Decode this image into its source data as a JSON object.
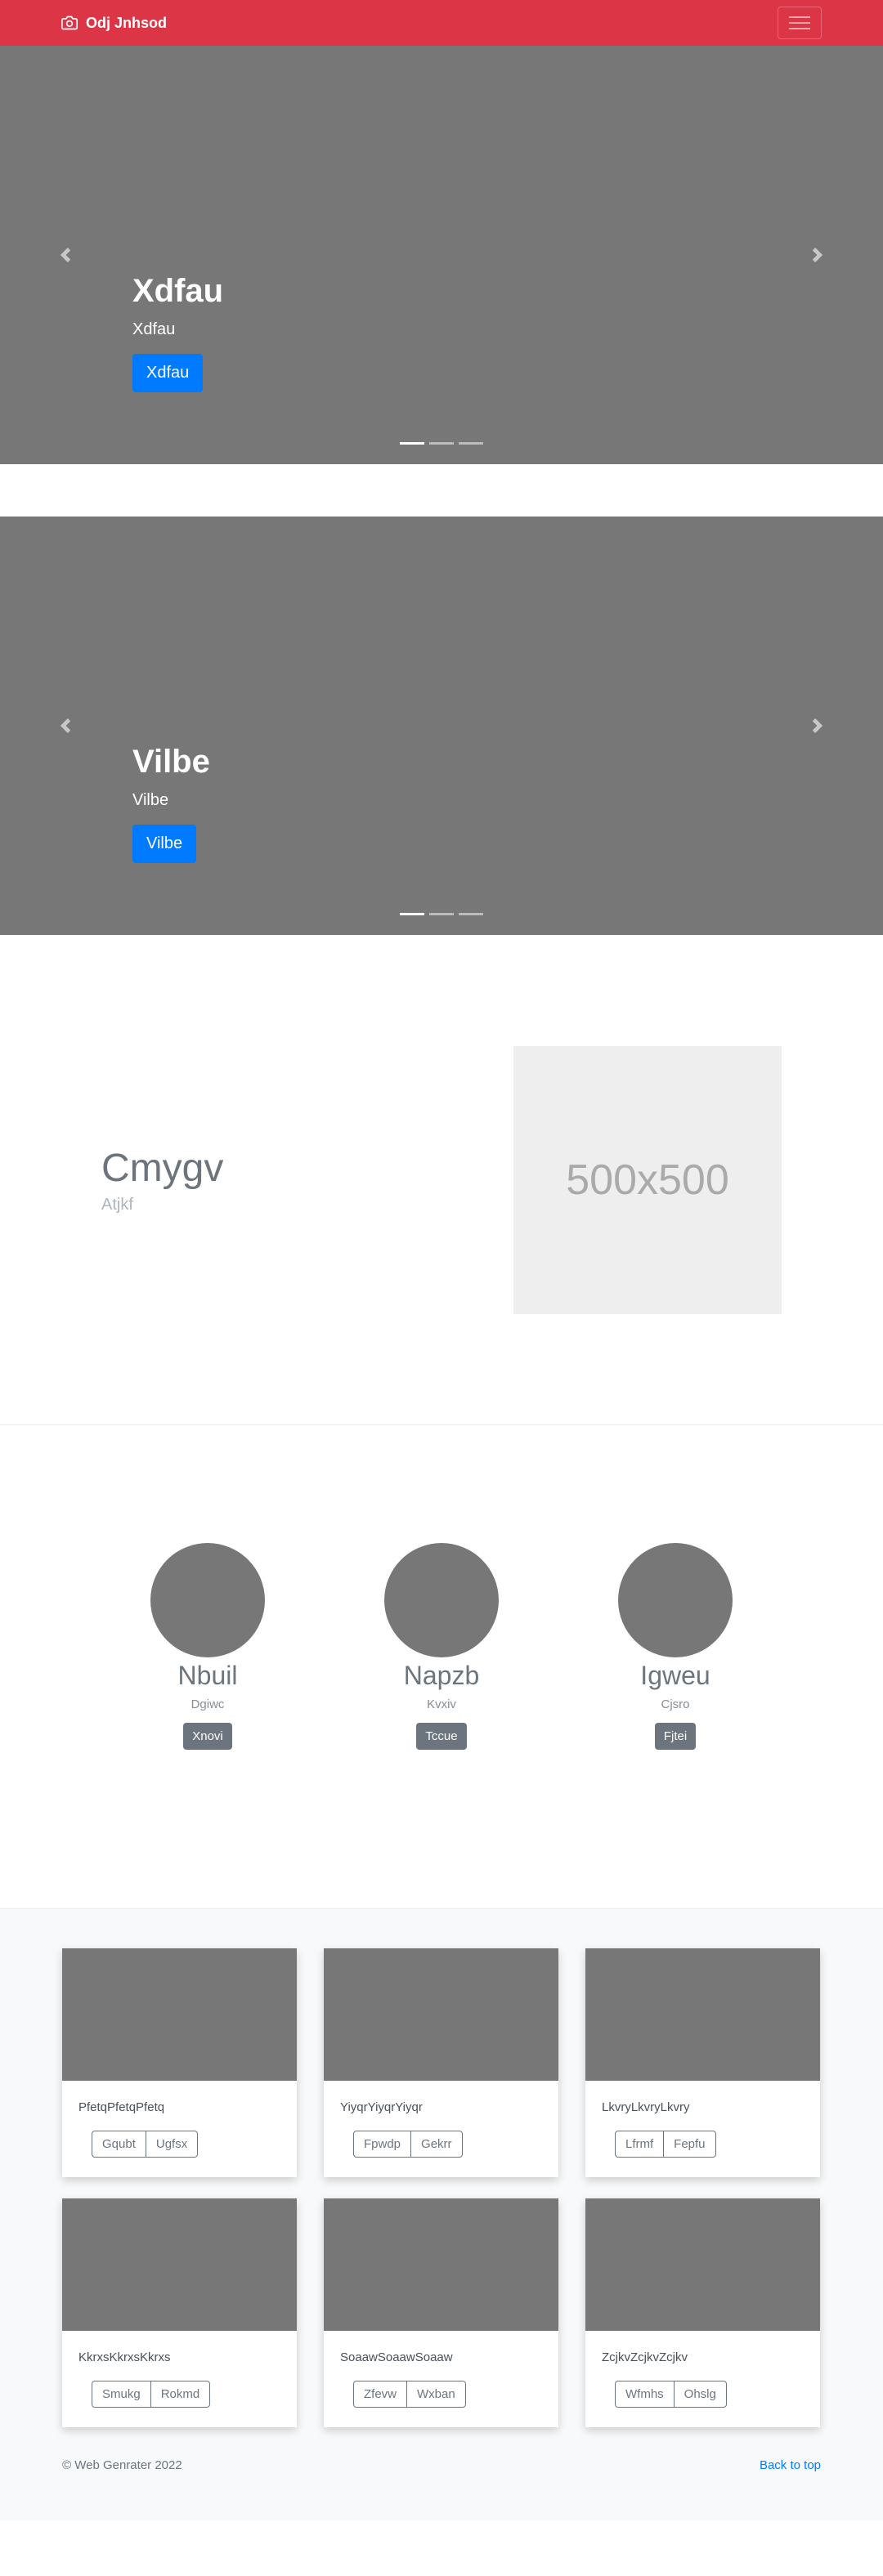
{
  "navbar": {
    "brand": "Odj Jnhsod",
    "brand_icon": "camera-icon",
    "bg_color": "#dc3545"
  },
  "carousels": [
    {
      "caption_title": "Xdfau",
      "caption_text": "Xdfau",
      "button_label": "Xdfau",
      "indicator_count": 3,
      "active_indicator": 0
    },
    {
      "caption_title": "Vilbe",
      "caption_text": "Vilbe",
      "button_label": "Vilbe",
      "indicator_count": 3,
      "active_indicator": 0
    }
  ],
  "feature": {
    "heading": "Cmygv",
    "subheading": "Atjkf",
    "placeholder_label": "500x500"
  },
  "team": [
    {
      "name": "Nbuil",
      "role": "Dgiwc",
      "button": "Xnovi"
    },
    {
      "name": "Napzb",
      "role": "Kvxiv",
      "button": "Tccue"
    },
    {
      "name": "Igweu",
      "role": "Cjsro",
      "button": "Fjtei"
    }
  ],
  "cards": [
    {
      "text": "PfetqPfetqPfetq",
      "buttons": [
        "Gqubt",
        "Ugfsx"
      ]
    },
    {
      "text": "YiyqrYiyqrYiyqr",
      "buttons": [
        "Fpwdp",
        "Gekrr"
      ]
    },
    {
      "text": "LkvryLkvryLkvry",
      "buttons": [
        "Lfrmf",
        "Fepfu"
      ]
    },
    {
      "text": "KkrxsKkrxsKkrxs",
      "buttons": [
        "Smukg",
        "Rokmd"
      ]
    },
    {
      "text": "SoaawSoaawSoaaw",
      "buttons": [
        "Zfevw",
        "Wxban"
      ]
    },
    {
      "text": "ZcjkvZcjkvZcjkv",
      "buttons": [
        "Wfmhs",
        "Ohslg"
      ]
    }
  ],
  "footer": {
    "copyright": "© Web Genrater 2022",
    "back_to_top": "Back to top"
  }
}
